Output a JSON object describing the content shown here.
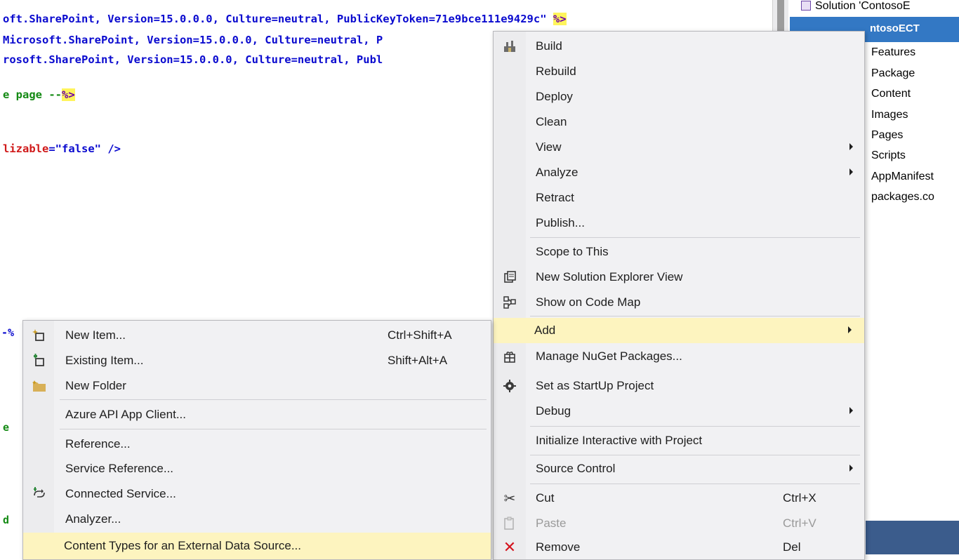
{
  "editor": {
    "line1_text": "oft.SharePoint, Version=15.0.0.0, Culture=neutral, PublicKeyToken=71e9bce111e9429c\" ",
    "line1_tag": "%>",
    "line2_text": "Microsoft.SharePoint, Version=15.0.0.0, Culture=neutral, P",
    "line3_text": "rosoft.SharePoint, Version=15.0.0.0, Culture=neutral, Publ",
    "line4_text": "e page --",
    "line4_tag": "%>",
    "line5_text_red": "lizable",
    "line5_text_blue": "=\"false\" />",
    "frag_add_row": "-%",
    "frag_e": "e",
    "frag_d": "d"
  },
  "solution_explorer": {
    "root_label": "Solution 'ContosoE",
    "selected_label": "ntosoECT",
    "items": [
      "Features",
      "Package",
      "Content",
      "Images",
      "Pages",
      "Scripts",
      "AppManifest",
      "packages.co"
    ]
  },
  "context_menu": {
    "items": [
      {
        "label": "Build",
        "icon": "build-icon"
      },
      {
        "label": "Rebuild"
      },
      {
        "label": "Deploy"
      },
      {
        "label": "Clean"
      },
      {
        "label": "View",
        "submenu": true
      },
      {
        "label": "Analyze",
        "submenu": true
      },
      {
        "label": "Retract"
      },
      {
        "label": "Publish..."
      },
      {
        "label": "Scope to This"
      },
      {
        "label": "New Solution Explorer View",
        "icon": "new-view-icon"
      },
      {
        "label": "Show on Code Map",
        "icon": "code-map-icon"
      },
      {
        "label": "Add",
        "submenu": true,
        "highlighted": true
      },
      {
        "label": "Manage NuGet Packages...",
        "icon": "nuget-icon"
      },
      {
        "label": "Set as StartUp Project",
        "icon": "gear-icon"
      },
      {
        "label": "Debug",
        "submenu": true
      },
      {
        "label": "Initialize Interactive with Project"
      },
      {
        "label": "Source Control",
        "submenu": true
      },
      {
        "label": "Cut",
        "shortcut": "Ctrl+X",
        "icon": "scissors-icon"
      },
      {
        "label": "Paste",
        "shortcut": "Ctrl+V",
        "icon": "paste-icon",
        "disabled": true
      },
      {
        "label": "Remove",
        "shortcut": "Del",
        "icon": "remove-icon"
      }
    ]
  },
  "add_menu": {
    "items": [
      {
        "label": "New Item...",
        "shortcut": "Ctrl+Shift+A",
        "icon": "new-item-icon"
      },
      {
        "label": "Existing Item...",
        "shortcut": "Shift+Alt+A",
        "icon": "existing-item-icon"
      },
      {
        "label": "New Folder",
        "icon": "folder-icon"
      },
      {
        "label": "Azure API App Client..."
      },
      {
        "label": "Reference..."
      },
      {
        "label": "Service Reference..."
      },
      {
        "label": "Connected Service...",
        "icon": "connected-service-icon"
      },
      {
        "label": "Analyzer..."
      },
      {
        "label": "Content Types for an External Data Source...",
        "highlighted": true
      }
    ]
  },
  "colors": {
    "menu_bg": "#f1f1f3",
    "highlight": "#fdf4bf",
    "selection": "#3378c4",
    "code_blue": "#0a0acf",
    "code_red": "#d01a1a",
    "code_green": "#148a14"
  }
}
